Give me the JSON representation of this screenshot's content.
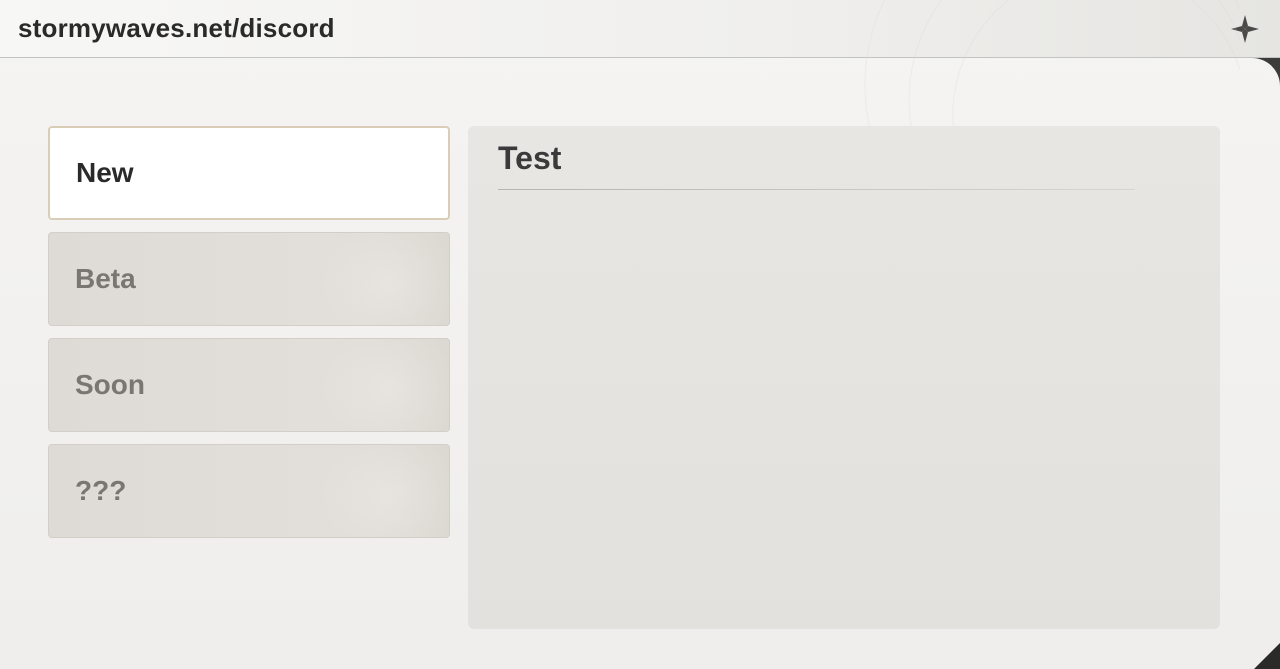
{
  "header": {
    "title": "stormywaves.net/discord"
  },
  "sidebar": {
    "items": [
      {
        "label": "New",
        "active": true
      },
      {
        "label": "Beta",
        "active": false
      },
      {
        "label": "Soon",
        "active": false
      },
      {
        "label": "???",
        "active": false
      }
    ]
  },
  "content": {
    "title": "Test"
  },
  "colors": {
    "active_border": "#d9cdb8",
    "inactive_bg": "#dedbd6",
    "text_primary": "#2a2a2a",
    "text_muted": "#7a7773"
  }
}
